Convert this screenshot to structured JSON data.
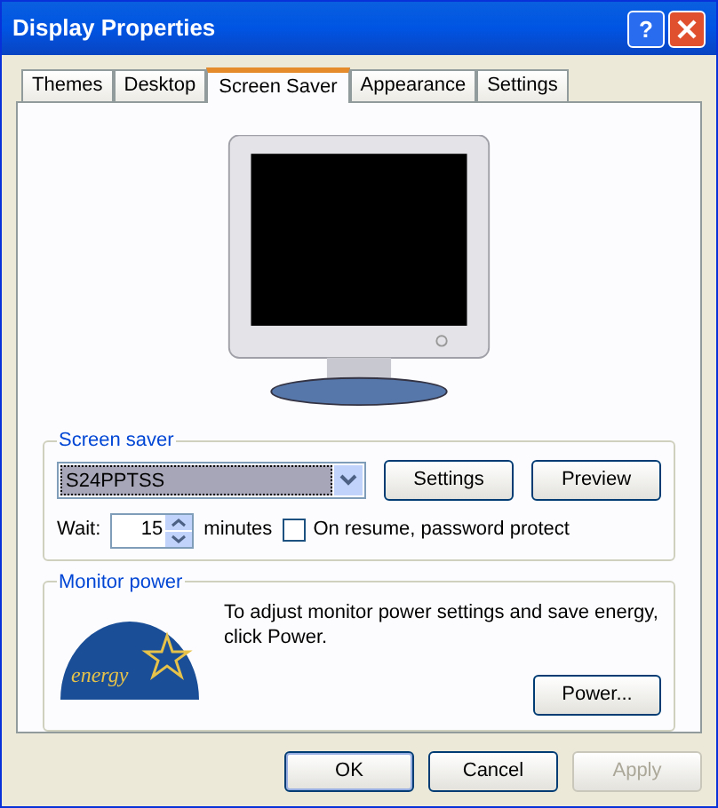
{
  "window": {
    "title": "Display Properties"
  },
  "title_buttons": [
    {
      "kind": "help",
      "label": "?"
    },
    {
      "kind": "close"
    }
  ],
  "tabs": [
    {
      "label": "Themes",
      "selected": false
    },
    {
      "label": "Desktop",
      "selected": false
    },
    {
      "label": "Screen Saver",
      "selected": true
    },
    {
      "label": "Appearance",
      "selected": false
    },
    {
      "label": "Settings",
      "selected": false
    }
  ],
  "screen_saver": {
    "legend": "Screen saver",
    "value": "S24PPTSS",
    "buttons": [
      {
        "label": "Settings"
      },
      {
        "label": "Preview"
      }
    ],
    "wait_label": "Wait:",
    "wait_value": "15",
    "minutes_label": "minutes",
    "password": {
      "label": "On resume, password protect",
      "checked": false
    }
  },
  "monitor_power": {
    "legend": "Monitor power",
    "logo_text": "energy",
    "text": "To adjust monitor power settings and save energy, click Power.",
    "button": "Power..."
  },
  "buttons": [
    {
      "label": "OK",
      "disabled": false,
      "default": true
    },
    {
      "label": "Cancel",
      "disabled": false,
      "default": false
    },
    {
      "label": "Apply",
      "disabled": true,
      "default": false
    }
  ]
}
